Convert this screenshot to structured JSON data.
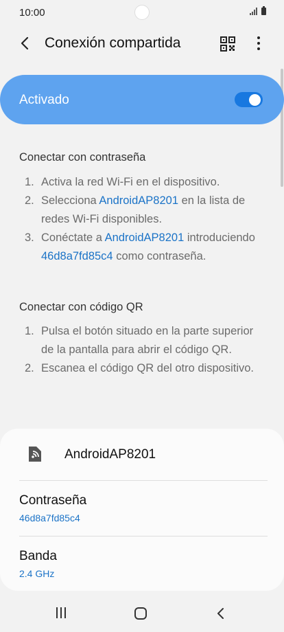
{
  "status_bar": {
    "time": "10:00"
  },
  "app_bar": {
    "title": "Conexión compartida",
    "back_icon": "chevron-left-icon",
    "qr_icon": "qr-code-icon",
    "more_icon": "more-vert-icon"
  },
  "toggle": {
    "label": "Activado",
    "state": "on",
    "accent": "#5ea3ef"
  },
  "password_section": {
    "title": "Conectar con contraseña",
    "steps": [
      {
        "num": "1.",
        "parts": [
          {
            "t": "Activa la red Wi-Fi en el dispositivo."
          }
        ]
      },
      {
        "num": "2.",
        "parts": [
          {
            "t": "Selecciona "
          },
          {
            "t": "AndroidAP8201",
            "hl": true
          },
          {
            "t": " en la lista de redes Wi-Fi disponibles."
          }
        ]
      },
      {
        "num": "3.",
        "parts": [
          {
            "t": "Conéctate a "
          },
          {
            "t": "AndroidAP8201",
            "hl": true
          },
          {
            "t": " introduciendo "
          },
          {
            "t": "46d8a7fd85c4",
            "hl": true
          },
          {
            "t": " como contraseña."
          }
        ]
      }
    ]
  },
  "qr_section": {
    "title": "Conectar con código QR",
    "steps": [
      {
        "num": "1.",
        "parts": [
          {
            "t": "Pulsa el botón situado en la parte superior de la pantalla para abrir el código QR."
          }
        ]
      },
      {
        "num": "2.",
        "parts": [
          {
            "t": "Escanea el código QR del otro dispositivo."
          }
        ]
      }
    ]
  },
  "info_card": {
    "network_name": "AndroidAP8201",
    "password_label": "Contraseña",
    "password_value": "46d8a7fd85c4",
    "band_label": "Banda",
    "band_value": "2.4 GHz"
  }
}
